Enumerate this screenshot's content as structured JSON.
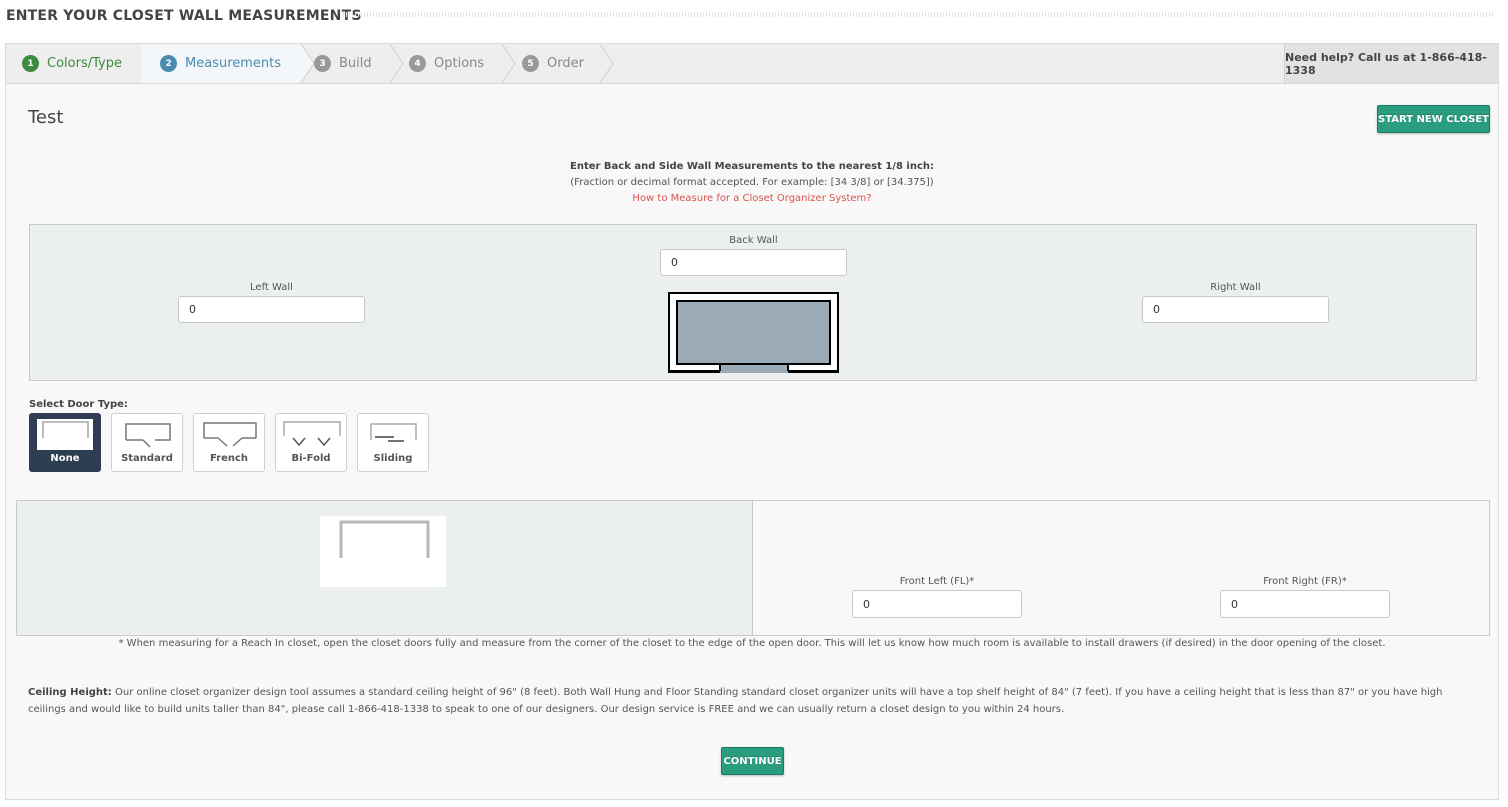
{
  "page_title": "ENTER YOUR CLOSET WALL MEASUREMENTS",
  "steps": [
    {
      "num": "1",
      "label": "Colors/Type"
    },
    {
      "num": "2",
      "label": "Measurements"
    },
    {
      "num": "3",
      "label": "Build"
    },
    {
      "num": "4",
      "label": "Options"
    },
    {
      "num": "5",
      "label": "Order"
    }
  ],
  "help_text": "Need help? Call us at 1-866-418-1338",
  "closet_name": "Test",
  "start_new_label": "START NEW CLOSET",
  "instructions": {
    "line1": "Enter Back and Side Wall Measurements to the nearest 1/8 inch:",
    "line2": "(Fraction or decimal format accepted.  For example: [34 3/8] or [34.375])",
    "link": "How to Measure for a Closet Organizer System?"
  },
  "walls": {
    "back": {
      "label": "Back Wall",
      "value": "0"
    },
    "left": {
      "label": "Left Wall",
      "value": "0"
    },
    "right": {
      "label": "Right Wall",
      "value": "0"
    }
  },
  "door_type": {
    "title": "Select Door Type:",
    "selected": "None",
    "options": [
      "None",
      "Standard",
      "French",
      "Bi-Fold",
      "Sliding"
    ]
  },
  "front": {
    "left": {
      "label": "Front Left (FL)*",
      "value": "0"
    },
    "right": {
      "label": "Front Right (FR)*",
      "value": "0"
    }
  },
  "note": "* When measuring for a Reach In closet, open the closet doors fully and measure from the corner of the closet to the edge of the open door.  This will let us know how much room is available to install drawers (if desired) in the door opening of the closet.",
  "ceiling": {
    "label": "Ceiling Height:",
    "text": " Our online closet organizer design tool assumes a standard ceiling height of 96\" (8 feet). Both Wall Hung and Floor Standing standard closet organizer units will have a top shelf height of 84\" (7 feet). If you have a ceiling height that is less than 87\" or you have high ceilings and would like to build units taller than 84\", please call 1-866-418-1338 to speak to one of our designers. Our design service is FREE and we can usually return a closet design to you within 24 hours."
  },
  "continue_label": "CONTINUE",
  "colors": {
    "accent_green": "#2a9d80",
    "active_step": "#4a8bb0",
    "done_step": "#3d8b40",
    "link_red": "#d9534f",
    "selected_door": "#2c3e50"
  }
}
